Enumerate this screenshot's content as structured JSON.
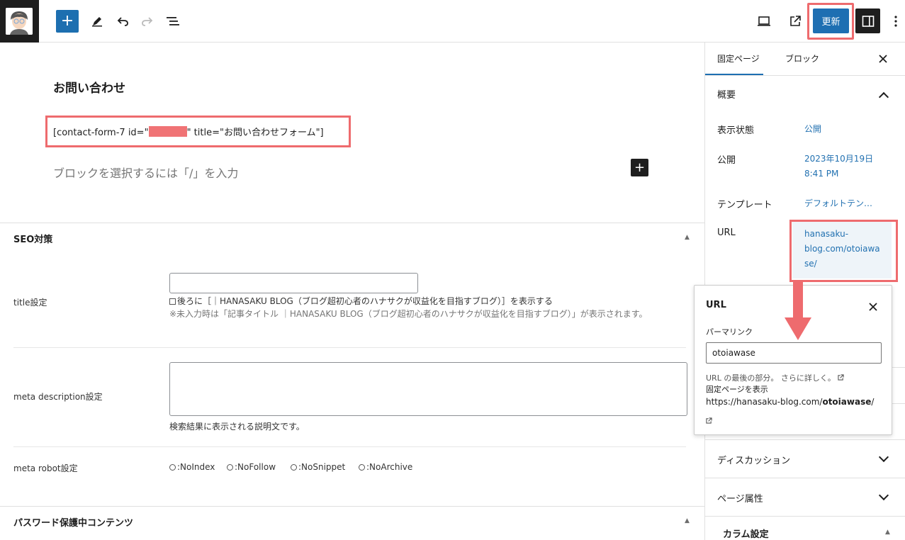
{
  "toolbar": {
    "update_label": "更新"
  },
  "editor": {
    "page_title": "お問い合わせ",
    "shortcode_prefix": "[contact-form-7 id=\"",
    "shortcode_suffix": "\" title=\"お問い合わせフォーム\"]",
    "block_placeholder": "ブロックを選択するには「/」を入力"
  },
  "seo": {
    "title": "SEO対策",
    "title_label": "title設定",
    "title_value": "",
    "title_checkbox": "後ろに［｜HANASAKU BLOG（ブログ超初心者のハナサクが収益化を目指すブログ）］を表示する",
    "title_note": "※未入力時は「記事タイトル ｜HANASAKU BLOG（ブログ超初心者のハナサクが収益化を目指すブログ）」が表示されます。",
    "desc_label": "meta description設定",
    "desc_value": "",
    "desc_note": "検索結果に表示される説明文です。",
    "robot_label": "meta robot設定",
    "robots": [
      ":NoIndex",
      ":NoFollow",
      ":NoSnippet",
      ":NoArchive"
    ]
  },
  "password_section": {
    "title": "パスワード保護中コンテンツ"
  },
  "sidebar": {
    "tabs": [
      "固定ページ",
      "ブロック"
    ],
    "summary_title": "概要",
    "visibility_label": "表示状態",
    "visibility_value": "公開",
    "publish_label": "公開",
    "publish_date": "2023年10月19日",
    "publish_time": "8:41 PM",
    "template_label": "テンプレート",
    "template_value": "デフォルトテン…",
    "url_label": "URL",
    "url_line1": "hanasaku-",
    "url_line2": "blog.com/otoiawa",
    "url_line3": "se/",
    "discussion_title": "ディスカッション",
    "page_attr_title": "ページ属性",
    "column_title": "カラム設定"
  },
  "popover": {
    "title": "URL",
    "permalink_label": "パーマリンク",
    "slug_value": "otoiawase",
    "help_text": "URL の最後の部分。",
    "learn_more": "さらに詳しく。",
    "view_label": "固定ページを表示",
    "link_prefix": "https://hanasaku-blog.com/",
    "link_slug": "otoiawase",
    "link_suffix": "/"
  },
  "colors": {
    "accent": "#1e6fb2",
    "highlight": "#ee6b6e",
    "link": "#2271b1"
  }
}
